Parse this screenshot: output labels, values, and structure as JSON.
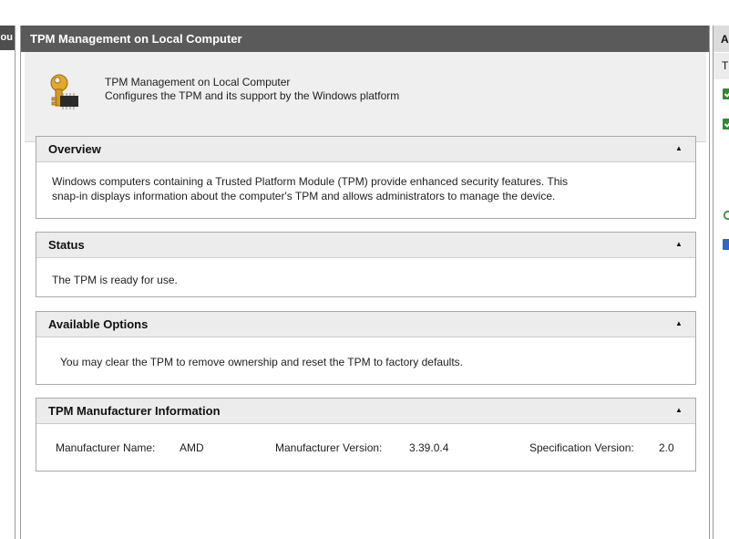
{
  "left_pane": {
    "header_fragment": "ou"
  },
  "main": {
    "title": "TPM Management on Local Computer",
    "intro": {
      "line1": "TPM Management on Local Computer",
      "line2": "Configures the TPM and its support by the Windows platform",
      "icon": "key-chip-icon"
    },
    "sections": {
      "overview": {
        "title": "Overview",
        "body_line1": "Windows computers containing a Trusted Platform Module (TPM) provide enhanced security features. This",
        "body_line2": "snap-in displays information about the computer's TPM and allows administrators to manage the device."
      },
      "status": {
        "title": "Status",
        "body": "The TPM is ready for use."
      },
      "available_options": {
        "title": "Available Options",
        "body": "You may clear the TPM to remove ownership and reset the TPM to factory defaults."
      },
      "manufacturer": {
        "title": "TPM Manufacturer Information",
        "name_label": "Manufacturer Name:",
        "name_value": "AMD",
        "version_label": "Manufacturer Version:",
        "version_value": "3.39.0.4",
        "spec_label": "Specification Version:",
        "spec_value": "2.0"
      }
    },
    "collapse_glyph": "▲"
  },
  "right_pane": {
    "header_fragment": "A",
    "row_fragment": "T",
    "icons": [
      "green-check-icon",
      "green-check-icon",
      "refresh-icon",
      "help-icon"
    ]
  },
  "colors": {
    "title_bar": "#5a5a5a",
    "intro_bg": "#efefef",
    "section_header_bg": "#ececec",
    "section_border": "#a9a9a9",
    "check_green": "#2e8b2e"
  }
}
